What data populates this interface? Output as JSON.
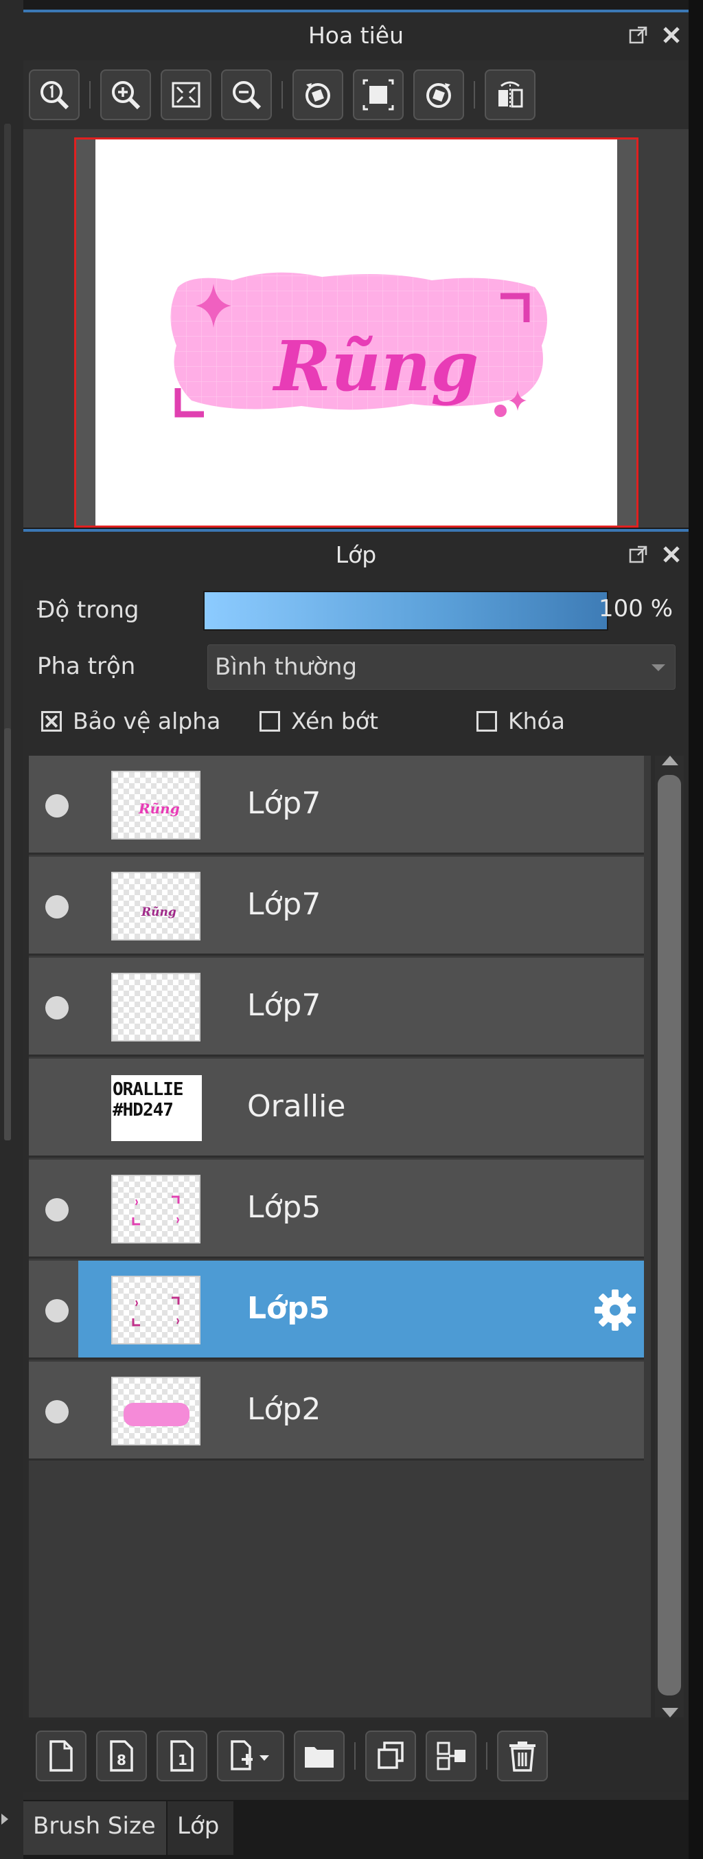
{
  "navigator": {
    "title": "Hoa tiêu",
    "toolbar_icons": [
      "actual-size-icon",
      "zoom-in-icon",
      "fit-screen-icon",
      "zoom-out-icon",
      "rotate-left-icon",
      "fit-canvas-icon",
      "rotate-right-icon",
      "flip-icon"
    ],
    "preview_text": "Rũng"
  },
  "layer_panel": {
    "title": "Lớp",
    "opacity_label": "Độ trong",
    "opacity_value": "100 %",
    "opacity_fraction": 1.0,
    "blend_label": "Pha trộn",
    "blend_value": "Bình thường",
    "protect_alpha": {
      "label": "Bảo vệ alpha",
      "checked": true
    },
    "clipping": {
      "label": "Xén bớt",
      "checked": false
    },
    "lock": {
      "label": "Khóa",
      "checked": false
    },
    "layers": [
      {
        "name": "Lớp7",
        "visible": true,
        "selected": false,
        "thumb": "text-pink"
      },
      {
        "name": "Lớp7",
        "visible": true,
        "selected": false,
        "thumb": "text-pink-small"
      },
      {
        "name": "Lớp7",
        "visible": true,
        "selected": false,
        "thumb": "empty"
      },
      {
        "name": "Orallie",
        "visible": false,
        "selected": false,
        "thumb": "watermark",
        "thumb_text": [
          "ORALLIE",
          "#HD247"
        ]
      },
      {
        "name": "Lớp5",
        "visible": true,
        "selected": false,
        "thumb": "corners"
      },
      {
        "name": "Lớp5",
        "visible": true,
        "selected": true,
        "thumb": "corners"
      },
      {
        "name": "Lớp2",
        "visible": true,
        "selected": false,
        "thumb": "pink-blob"
      }
    ],
    "bottom_toolbar_icons": [
      "new-layer-icon",
      "new-8bit-layer-icon",
      "new-1bit-layer-icon",
      "add-layer-menu-icon",
      "new-folder-icon",
      "duplicate-layer-icon",
      "merge-layer-icon",
      "delete-layer-icon"
    ]
  },
  "tabs": [
    {
      "label": "Brush Size",
      "active": false
    },
    {
      "label": "Lớp",
      "active": true
    }
  ],
  "colors": {
    "accent": "#4d9bd4",
    "header_line": "#3b78b5",
    "nav_border": "#e02020",
    "pink": "#f060c0",
    "pink_light": "#ffaee6"
  }
}
